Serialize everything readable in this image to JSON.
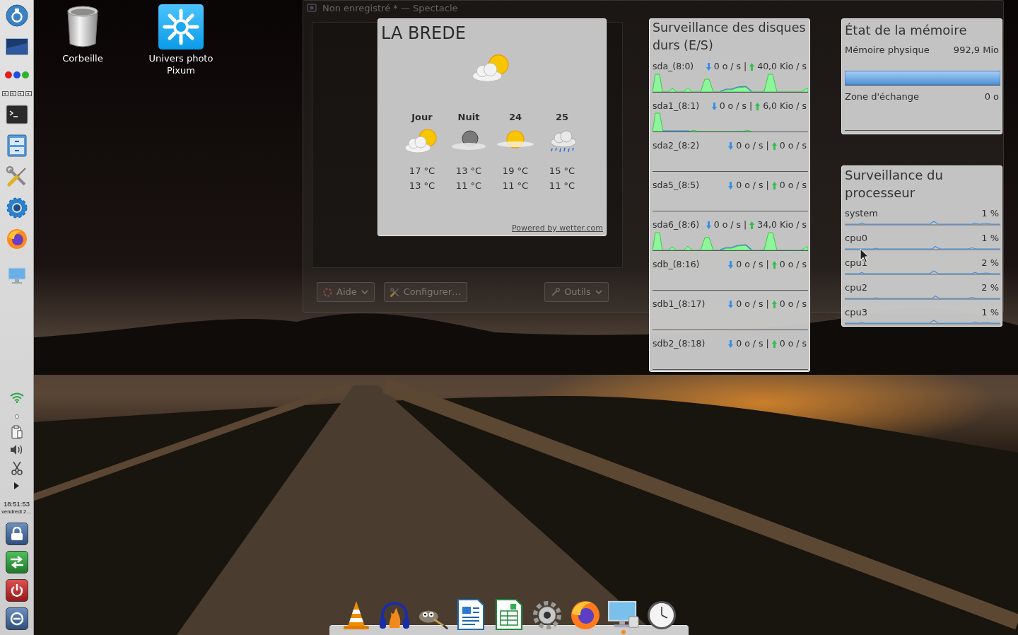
{
  "panel": {
    "launchers": [
      {
        "kind": "launcher"
      },
      {
        "kind": "desktop"
      },
      {
        "kind": "balls"
      },
      {
        "kind": "pager"
      },
      {
        "kind": "terminal"
      },
      {
        "kind": "filer"
      },
      {
        "kind": "tools"
      },
      {
        "kind": "settings"
      },
      {
        "kind": "browser"
      },
      {
        "kind": "display"
      }
    ],
    "tray": [
      {
        "kind": "wifi"
      },
      {
        "kind": "dot"
      },
      {
        "kind": "clipboard"
      },
      {
        "kind": "volume"
      },
      {
        "kind": "scissors"
      },
      {
        "kind": "expand"
      }
    ],
    "clock": {
      "time": "18:51:53",
      "date": "vendredi 2…"
    },
    "session": [
      {
        "kind": "lock"
      },
      {
        "kind": "switch"
      },
      {
        "kind": "shutdown"
      },
      {
        "kind": "logout"
      }
    ]
  },
  "desktop_icons": [
    {
      "kind": "trash",
      "label": "Corbeille"
    },
    {
      "kind": "photo",
      "label": "Univers photo Pixum"
    }
  ],
  "window": {
    "title": "Non enregistré * — Spectacle",
    "toolbar": [
      {
        "label": "Aide",
        "menu": true
      },
      {
        "label": "Configurer…",
        "menu": false
      },
      {
        "label": "Outils",
        "menu": true
      }
    ]
  },
  "weather": {
    "location": "LA BREDE",
    "current": {
      "kind": "partly_cloudy"
    },
    "days": [
      {
        "label": "Jour",
        "kind": "partly_cloudy",
        "high": "17 °C",
        "low": "13 °C"
      },
      {
        "label": "Nuit",
        "kind": "night_cloudy",
        "high": "13 °C",
        "low": "11 °C"
      },
      {
        "label": "24",
        "kind": "hazy_sun",
        "high": "19 °C",
        "low": "11 °C"
      },
      {
        "label": "25",
        "kind": "rain",
        "high": "15 °C",
        "low": "11 °C"
      }
    ],
    "credit": "Powered by wetter.com"
  },
  "disk_monitor": {
    "title": "Surveillance des disques durs (E/S)",
    "separator": "|",
    "rows": [
      {
        "name": "sda_(8:0)",
        "read": "0 o / s",
        "write": "40,0 Kio / s",
        "kind": "busy"
      },
      {
        "name": "sda1_(8:1)",
        "read": "0 o / s",
        "write": "6,0 Kio / s",
        "kind": "spike"
      },
      {
        "name": "sda2_(8:2)",
        "read": "0 o / s",
        "write": "0 o / s",
        "kind": "idle"
      },
      {
        "name": "sda5_(8:5)",
        "read": "0 o / s",
        "write": "0 o / s",
        "kind": "idle"
      },
      {
        "name": "sda6_(8:6)",
        "read": "0 o / s",
        "write": "34,0 Kio / s",
        "kind": "busy"
      },
      {
        "name": "sdb_(8:16)",
        "read": "0 o / s",
        "write": "0 o / s",
        "kind": "idle"
      },
      {
        "name": "sdb1_(8:17)",
        "read": "0 o / s",
        "write": "0 o / s",
        "kind": "idle"
      },
      {
        "name": "sdb2_(8:18)",
        "read": "0 o / s",
        "write": "0 o / s",
        "kind": "idle"
      }
    ]
  },
  "memory": {
    "title": "État de la mémoire",
    "rows": [
      {
        "label": "Mémoire physique",
        "value": "992,9 Mio",
        "kind": "filled"
      },
      {
        "label": "Zone d'échange",
        "value": "0 o",
        "kind": "empty"
      }
    ]
  },
  "cpu": {
    "title": "Surveillance du processeur",
    "rows": [
      {
        "name": "system",
        "value": "1 %"
      },
      {
        "name": "cpu0",
        "value": "1 %"
      },
      {
        "name": "cpu1",
        "value": "2 %"
      },
      {
        "name": "cpu2",
        "value": "2 %"
      },
      {
        "name": "cpu3",
        "value": "1 %"
      }
    ]
  },
  "dock": {
    "apps": [
      {
        "kind": "cone",
        "running": false
      },
      {
        "kind": "headphones",
        "running": false
      },
      {
        "kind": "painter",
        "running": false
      },
      {
        "kind": "writer",
        "running": false
      },
      {
        "kind": "calc",
        "running": false
      },
      {
        "kind": "gear",
        "running": false
      },
      {
        "kind": "browser",
        "running": false
      },
      {
        "kind": "display",
        "running": true
      },
      {
        "kind": "clock",
        "running": false
      }
    ]
  }
}
